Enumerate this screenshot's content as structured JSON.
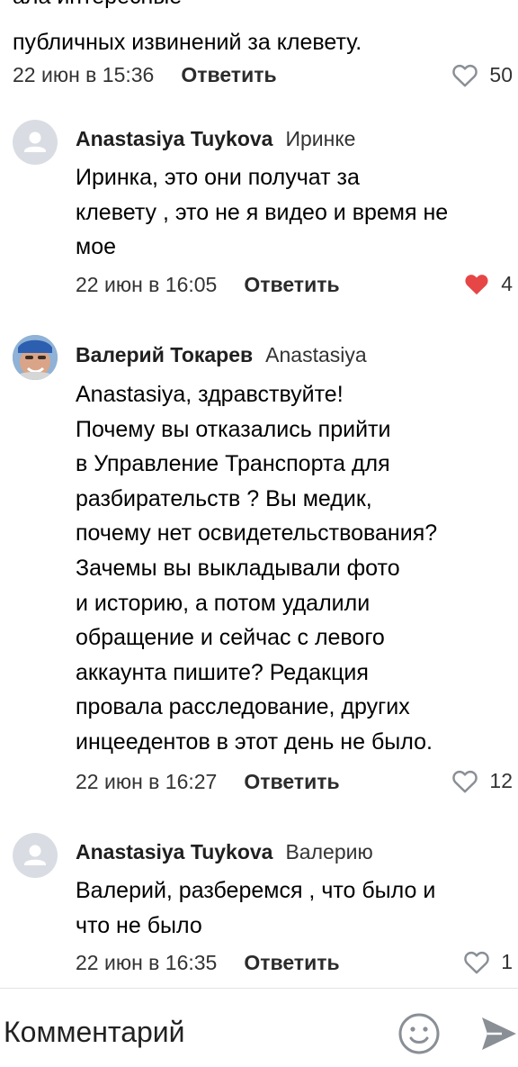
{
  "previous": {
    "cut_line": "ала интересные",
    "line": "публичных извинений за клевету.",
    "time": "22 июн в 15:36",
    "reply": "Ответить",
    "likes": "50"
  },
  "comments": [
    {
      "author": "Anastasiya Tuykova",
      "reply_to": "Иринке",
      "text": "Иринка, это они получат за\nклевету , это не я видео и время не\nмое",
      "time": "22 июн в 16:05",
      "reply": "Ответить",
      "likes": "4",
      "liked": true
    },
    {
      "author": "Валерий Токарев",
      "reply_to": "Anastasiya",
      "text": "Anastasiya, здравствуйте!\nПочему вы отказались прийти\nв Управление Транспорта для\nразбирательств ? Вы медик,\nпочему нет освидетельствования?\nЗачемы вы выкладывали фото\nи историю, а потом удалили\nобращение и сейчас с левого\nаккаунта пишите? Редакция\nпровала расследование, других\nинцеедентов в этот день не было.",
      "time": "22 июн в 16:27",
      "reply": "Ответить",
      "likes": "12",
      "liked": false
    },
    {
      "author": "Anastasiya Tuykova",
      "reply_to": "Валерию",
      "text": "Валерий, разберемся , что было и\nчто не было",
      "time": "22 июн в 16:35",
      "reply": "Ответить",
      "likes": "1",
      "liked": false
    }
  ],
  "composer": {
    "placeholder": "Комментарий",
    "emoji_icon": "smile-icon",
    "send_icon": "send-icon"
  },
  "colors": {
    "like_active": "#e64646",
    "icon_gray": "#8a8f96",
    "avatar_bg": "#d9dde3"
  }
}
